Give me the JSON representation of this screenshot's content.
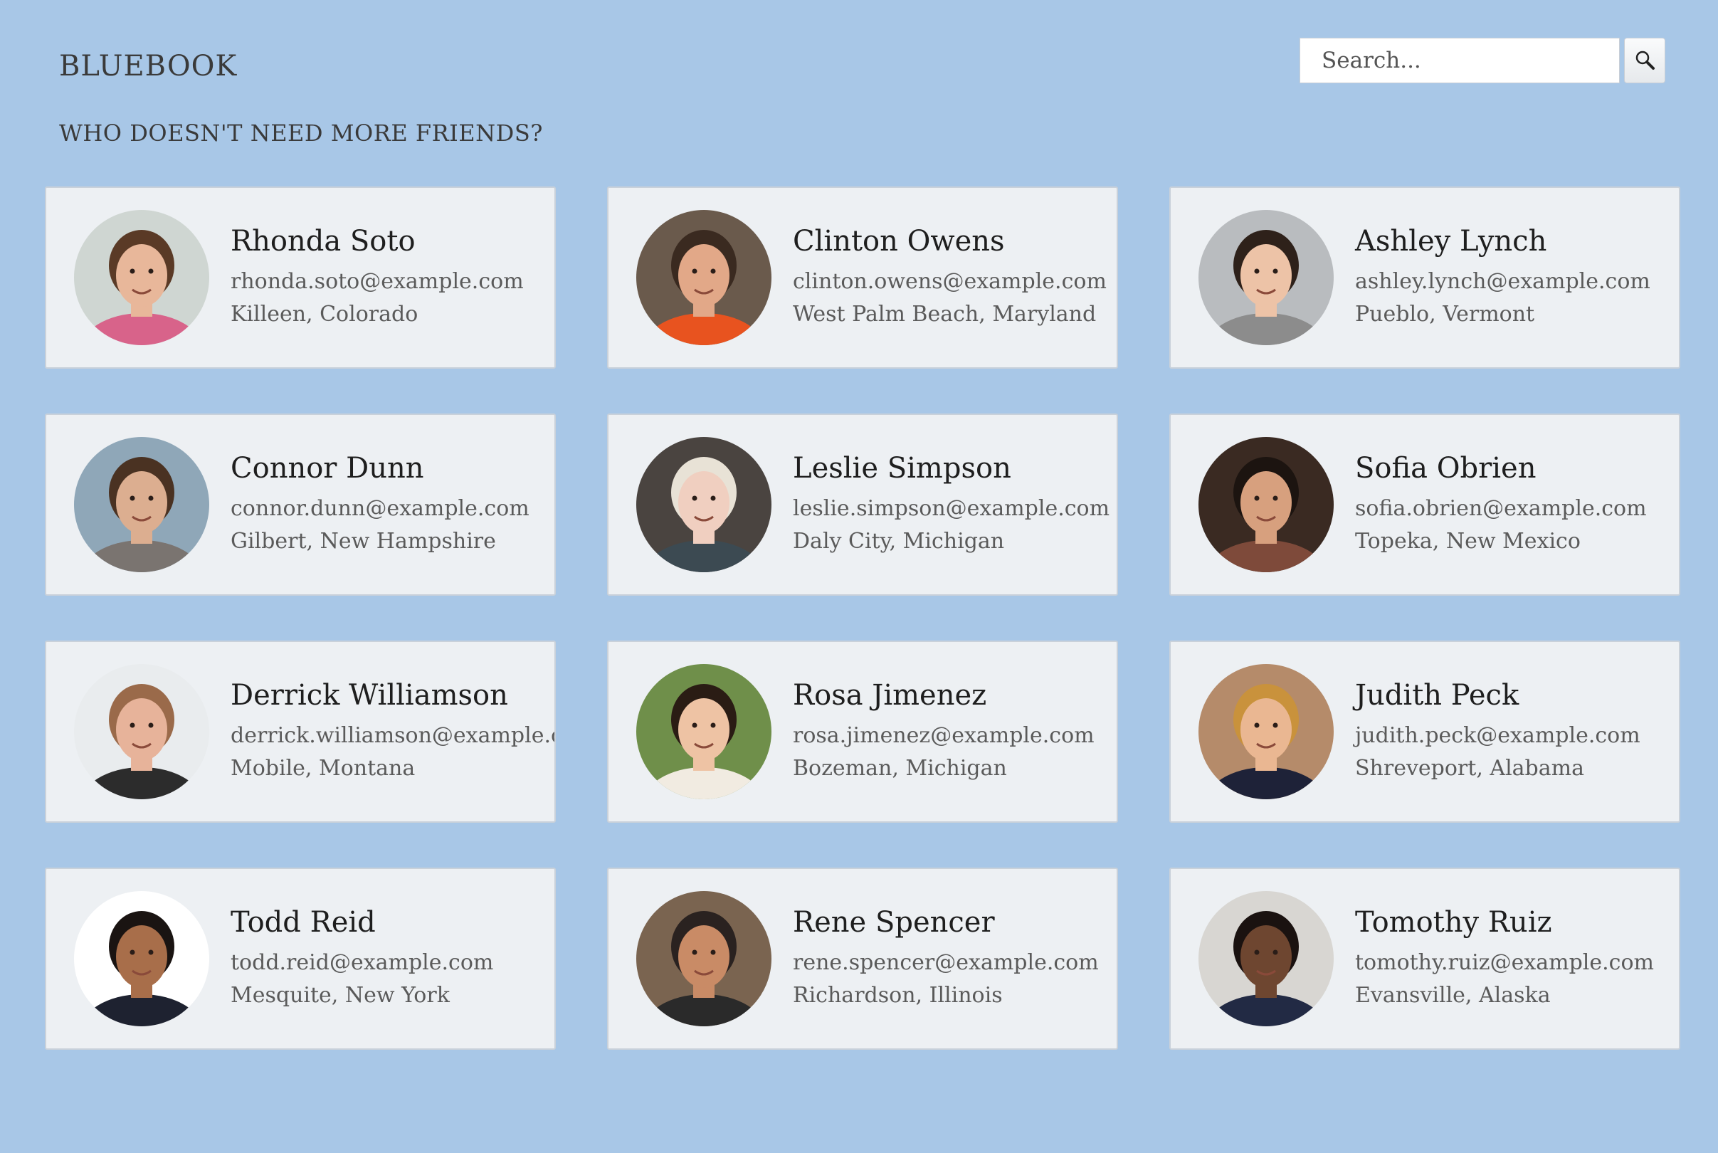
{
  "app": {
    "brand": "BLUEBOOK",
    "tagline": "WHO DOESN'T NEED MORE FRIENDS?"
  },
  "search": {
    "placeholder": "Search...",
    "value": "",
    "icon": "magnifier-icon"
  },
  "friends": [
    {
      "name": "Rhonda Soto",
      "email": "rhonda.soto@example.com",
      "location": "Killeen, Colorado",
      "avatar": {
        "bg": "#cfd6d2",
        "skin": "#e8b79a",
        "hair": "#5a3a26",
        "shirt": "#d8638a"
      }
    },
    {
      "name": "Clinton Owens",
      "email": "clinton.owens@example.com",
      "location": "West Palm Beach, Maryland",
      "avatar": {
        "bg": "#6a5a4c",
        "skin": "#e2a888",
        "hair": "#3a2a20",
        "shirt": "#e8531f"
      }
    },
    {
      "name": "Ashley Lynch",
      "email": "ashley.lynch@example.com",
      "location": "Pueblo, Vermont",
      "avatar": {
        "bg": "#b9bcbf",
        "skin": "#edc3a7",
        "hair": "#2e211a",
        "shirt": "#8c8c8c"
      }
    },
    {
      "name": "Connor Dunn",
      "email": "connor.dunn@example.com",
      "location": "Gilbert, New Hampshire",
      "avatar": {
        "bg": "#8fa7b8",
        "skin": "#dcae90",
        "hair": "#4a3222",
        "shirt": "#7a7470"
      }
    },
    {
      "name": "Leslie Simpson",
      "email": "leslie.simpson@example.com",
      "location": "Daly City, Michigan",
      "avatar": {
        "bg": "#4a4440",
        "skin": "#f0cfc0",
        "hair": "#e8e2d6",
        "shirt": "#3c4a52"
      }
    },
    {
      "name": "Sofia Obrien",
      "email": "sofia.obrien@example.com",
      "location": "Topeka, New Mexico",
      "avatar": {
        "bg": "#3a2a22",
        "skin": "#d7a07e",
        "hair": "#1c1410",
        "shirt": "#7e4a3a"
      }
    },
    {
      "name": "Derrick Williamson",
      "email": "derrick.williamson@example.com",
      "location": "Mobile, Montana",
      "avatar": {
        "bg": "#e9ecee",
        "skin": "#e7b39a",
        "hair": "#9a6a4a",
        "shirt": "#2c2c2c"
      }
    },
    {
      "name": "Rosa Jimenez",
      "email": "rosa.jimenez@example.com",
      "location": "Bozeman, Michigan",
      "avatar": {
        "bg": "#6f8f4a",
        "skin": "#eec3a4",
        "hair": "#2a1c14",
        "shirt": "#f1ebe1"
      }
    },
    {
      "name": "Judith Peck",
      "email": "judith.peck@example.com",
      "location": "Shreveport, Alabama",
      "avatar": {
        "bg": "#b58b6a",
        "skin": "#eab792",
        "hair": "#c9923c",
        "shirt": "#1e2238"
      }
    },
    {
      "name": "Todd Reid",
      "email": "todd.reid@example.com",
      "location": "Mesquite, New York",
      "avatar": {
        "bg": "#ffffff",
        "skin": "#a86e4a",
        "hair": "#1a1412",
        "shirt": "#1e2230"
      }
    },
    {
      "name": "Rene Spencer",
      "email": "rene.spencer@example.com",
      "location": "Richardson, Illinois",
      "avatar": {
        "bg": "#7a6450",
        "skin": "#c98b66",
        "hair": "#2a2220",
        "shirt": "#2a2a2a"
      }
    },
    {
      "name": "Tomothy Ruiz",
      "email": "tomothy.ruiz@example.com",
      "location": "Evansville, Alaska",
      "avatar": {
        "bg": "#d8d6d2",
        "skin": "#6e4630",
        "hair": "#1a1210",
        "shirt": "#222a44"
      }
    }
  ]
}
